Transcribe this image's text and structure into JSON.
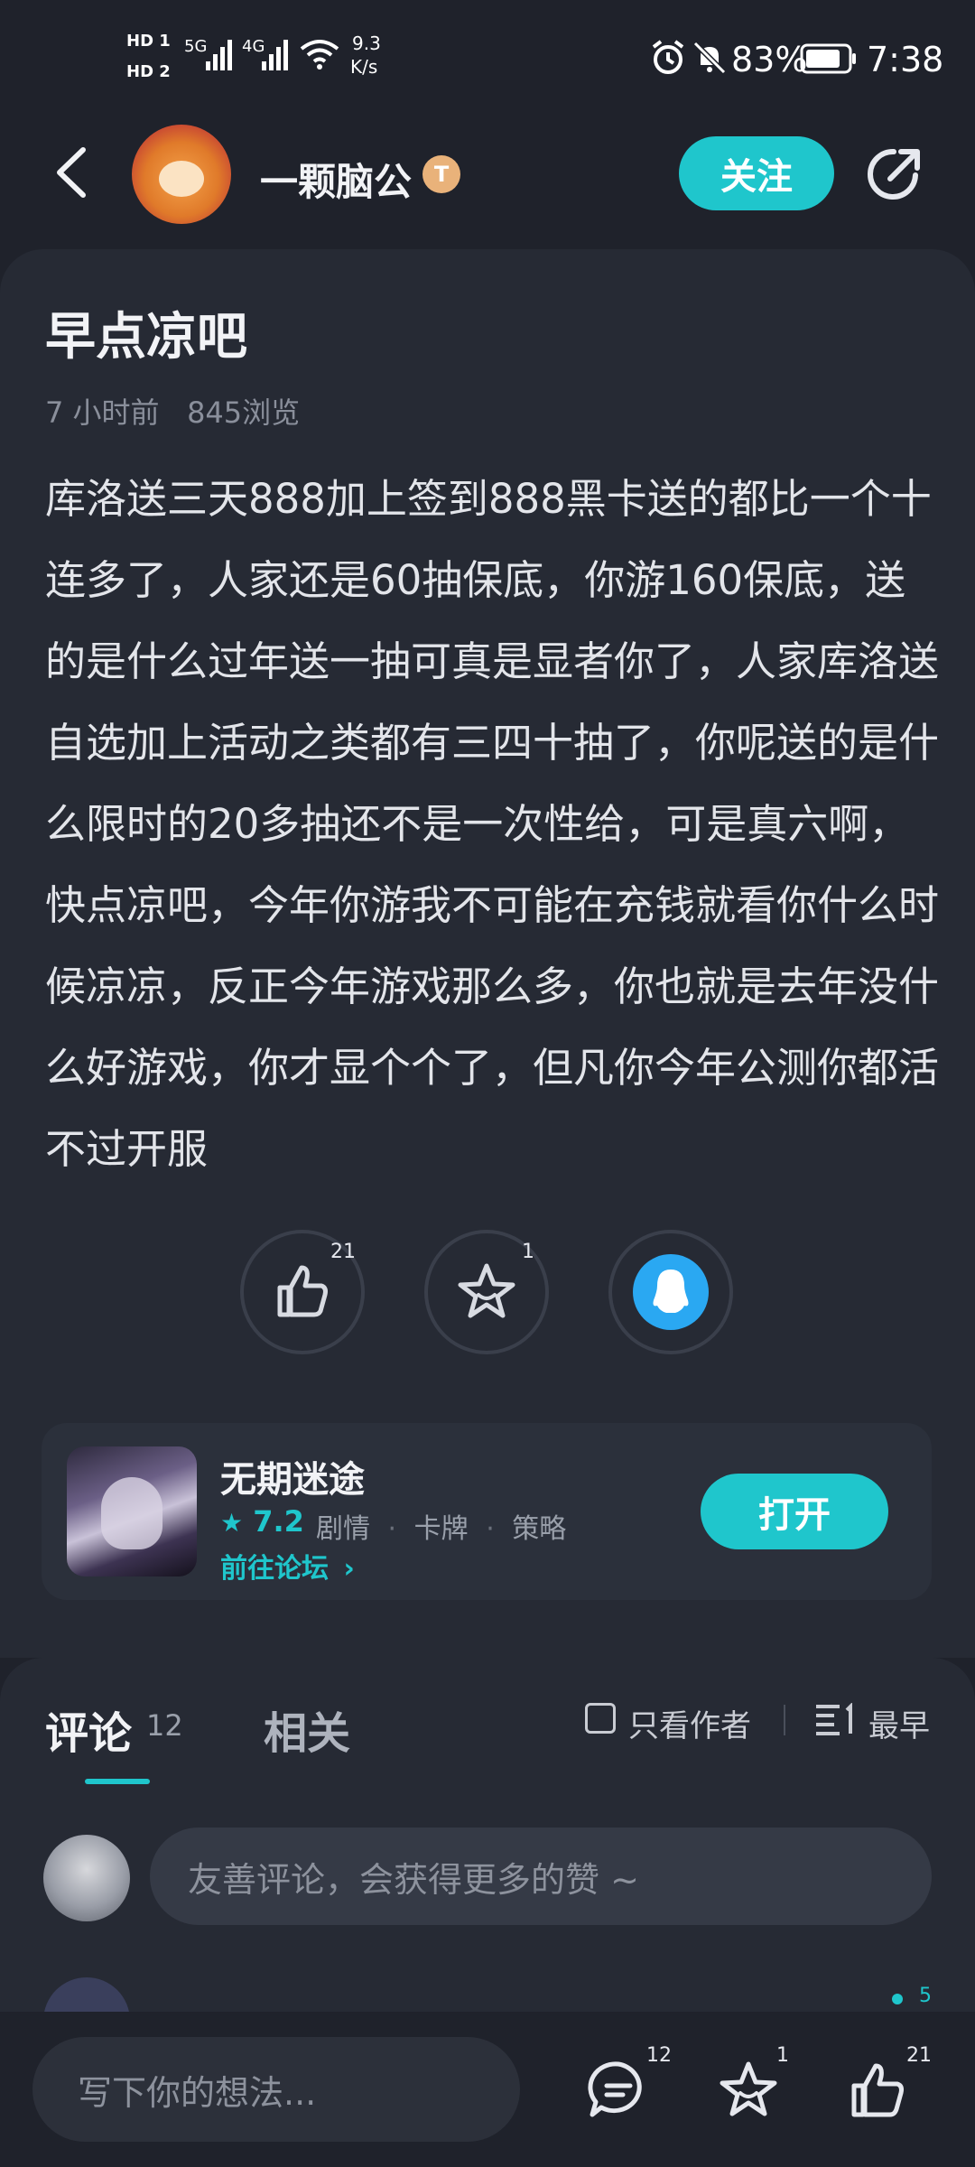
{
  "status_bar": {
    "hd1": "HD 1",
    "hd2": "HD 2",
    "net1": "5G",
    "net2": "4G",
    "speed_value": "9.3",
    "speed_unit": "K/s",
    "battery": "83%",
    "time": "7:38"
  },
  "header": {
    "author_name": "一颗脑公",
    "author_badge": "T",
    "follow_label": "关注"
  },
  "post": {
    "title": "早点凉吧",
    "time_ago": "7 小时前",
    "views": "845浏览",
    "body": "库洛送三天888加上签到888黑卡送的都比一个十连多了，人家还是60抽保底，你游160保底，送的是什么过年送一抽可真是显者你了，人家库洛送自选加上活动之类都有三四十抽了，你呢送的是什么限时的20多抽还不是一次性给，可是真六啊，快点凉吧，今年你游我不可能在充钱就看你什么时候凉凉，反正今年游戏那么多，你也就是去年没什么好游戏，你才显个个了，但凡你今年公测你都活不过开服"
  },
  "actions": {
    "like_count": "21",
    "fav_count": "1"
  },
  "game": {
    "name": "无期迷途",
    "rating": "7.2",
    "tags": [
      "剧情",
      "卡牌",
      "策略"
    ],
    "forum_link": "前往论坛",
    "open_label": "打开"
  },
  "comments": {
    "tab_comments": "评论",
    "comment_count": "12",
    "tab_related": "相关",
    "author_only": "只看作者",
    "sort_label": "最早",
    "input_placeholder": "友善评论，会获得更多的赞 ~",
    "next_like_count": "5"
  },
  "bottom_bar": {
    "write_placeholder": "写下你的想法...",
    "comment_badge": "12",
    "fav_badge": "1",
    "like_badge": "21"
  },
  "colors": {
    "accent": "#1fc6cc",
    "background": "#1f222b",
    "card": "#262a34",
    "qq_blue": "#2aa8f2"
  }
}
